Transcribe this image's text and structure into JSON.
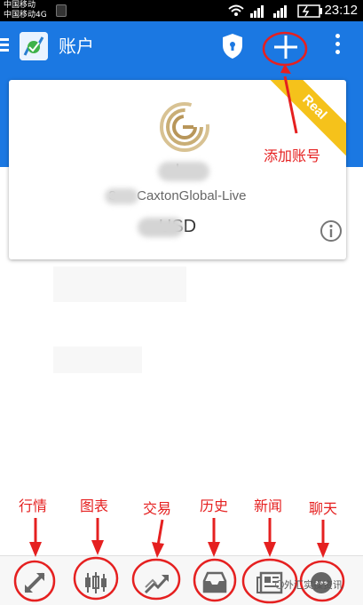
{
  "status_bar": {
    "carrier_line1": "中国移动",
    "carrier_line2": "中国移动4G",
    "time": "23:12"
  },
  "app_bar": {
    "title": "账户"
  },
  "account_card": {
    "name": "I",
    "server": "3 — CaxtonGlobal-Live",
    "balance": "USD",
    "badge": "Real"
  },
  "annotations": {
    "add_account": "添加账号",
    "quotes": "行情",
    "charts": "图表",
    "trade": "交易",
    "history": "历史",
    "news": "新闻",
    "chat": "聊天"
  },
  "watermark": "外汇实操资讯",
  "colors": {
    "primary": "#1b78e2",
    "ribbon": "#f5c21b",
    "annotation": "#e52020"
  },
  "icons": {
    "bottom_nav": [
      "quotes-icon",
      "chart-icon",
      "trade-icon",
      "history-icon",
      "news-icon",
      "chat-icon"
    ]
  }
}
